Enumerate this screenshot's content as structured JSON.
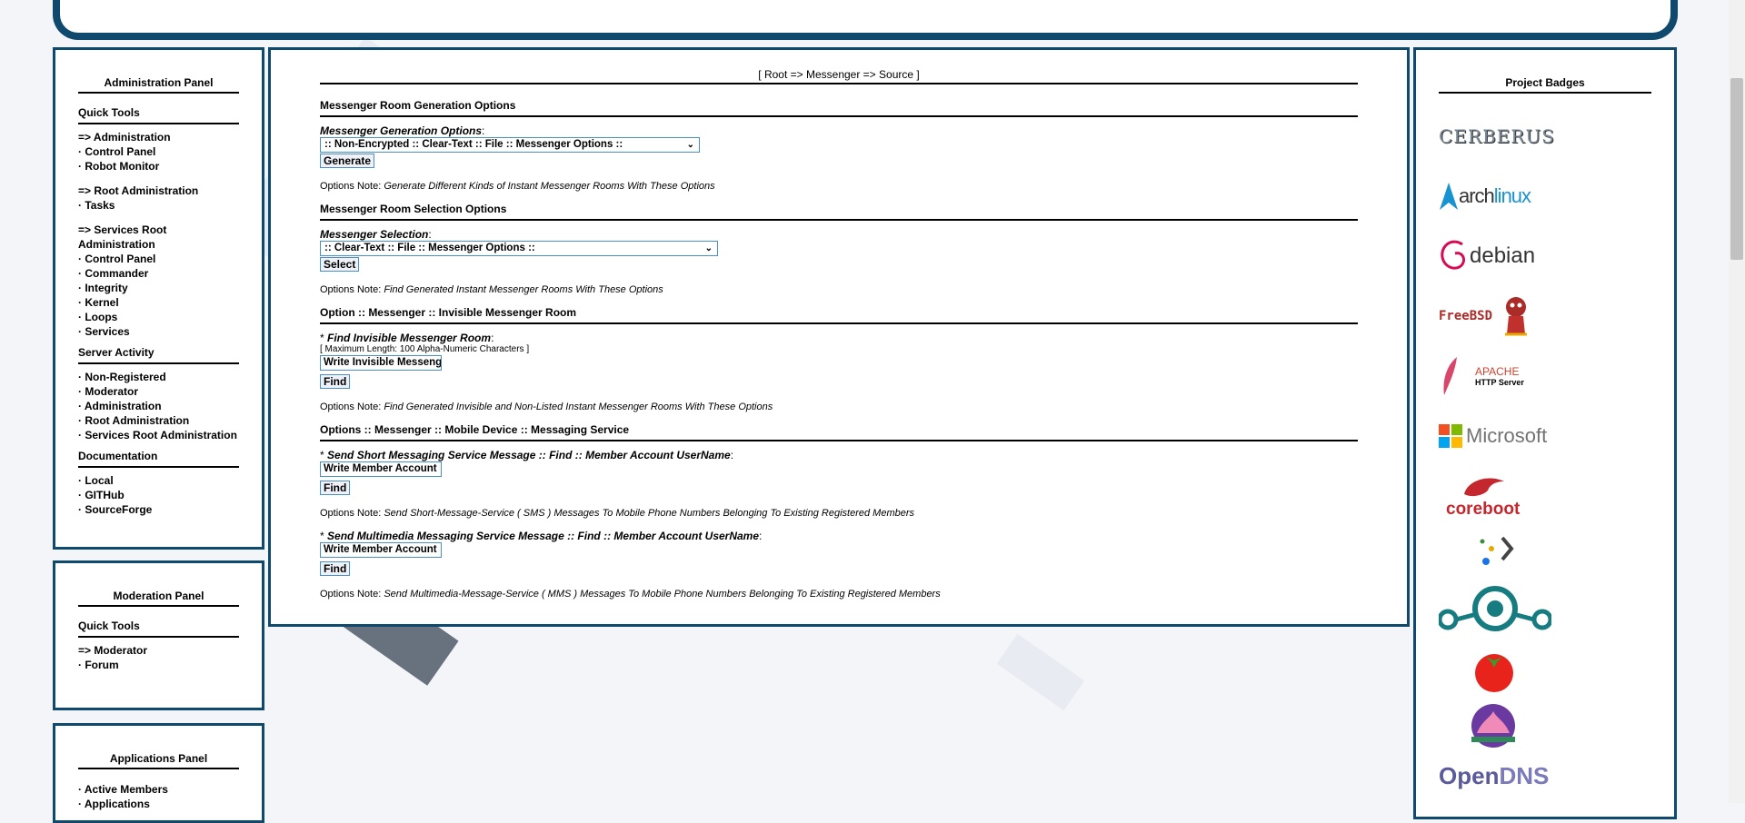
{
  "admin_panel": {
    "title": "Administration Panel",
    "sections": [
      {
        "heading": "Quick Tools",
        "groups": [
          [
            "=> Administration",
            "· Control Panel",
            "· Robot Monitor"
          ],
          [
            "=> Root Administration",
            "· Tasks"
          ],
          [
            "=> Services Root Administration",
            "· Control Panel",
            "· Commander",
            "· Integrity",
            "· Kernel",
            "· Loops",
            "· Services"
          ]
        ]
      },
      {
        "heading": "Server Activity",
        "groups": [
          [
            "· Non-Registered",
            "· Moderator",
            "· Administration",
            "· Root Administration",
            "· Services Root Administration"
          ]
        ]
      },
      {
        "heading": "Documentation",
        "groups": [
          [
            "· Local",
            "· GITHub",
            "· SourceForge"
          ]
        ]
      }
    ]
  },
  "moderation_panel": {
    "title": "Moderation Panel",
    "heading": "Quick Tools",
    "items": [
      "=> Moderator",
      "· Forum"
    ]
  },
  "applications_panel": {
    "title": "Applications Panel",
    "items": [
      "· Active Members",
      "· Applications"
    ]
  },
  "main": {
    "breadcrumb": "[ Root => Messenger => Source ]",
    "gen": {
      "heading": "Messenger Room Generation Options",
      "label": "Messenger Generation Options",
      "select_value": ":: Non-Encrypted :: Clear-Text :: File :: Messenger Options ::",
      "button": "Generate",
      "note_prefix": "Options Note: ",
      "note": "Generate Different Kinds of Instant Messenger Rooms With These Options"
    },
    "selection": {
      "heading": "Messenger Room Selection Options",
      "label": "Messenger Selection",
      "select_value": ":: Clear-Text :: File :: Messenger Options ::",
      "button": "Select",
      "note_prefix": "Options Note: ",
      "note": "Find Generated Instant Messenger Rooms With These Options"
    },
    "invisible": {
      "heading": "Option :: Messenger :: Invisible Messenger Room",
      "star": "* ",
      "label": "Find Invisible Messenger Room",
      "hint": "[ Maximum Length: 100 Alpha-Numeric Characters ]",
      "input_value": "Write Invisible Messenger Room",
      "button": "Find",
      "note_prefix": "Options Note: ",
      "note": "Find Generated Invisible and Non-Listed Instant Messenger Rooms With These Options"
    },
    "mobile": {
      "heading": "Options :: Messenger :: Mobile Device :: Messaging Service",
      "sms_star": "* ",
      "sms_label": "Send Short Messaging Service Message :: Find :: Member Account UserName",
      "sms_input": "Write Member Account",
      "sms_button": "Find",
      "sms_note_prefix": "Options Note: ",
      "sms_note": "Send Short-Message-Service ( SMS ) Messages To Mobile Phone Numbers Belonging To Existing Registered Members",
      "mms_star": "* ",
      "mms_label": "Send Multimedia Messaging Service Message :: Find :: Member Account UserName",
      "mms_input": "Write Member Account",
      "mms_button": "Find",
      "mms_note_prefix": "Options Note: ",
      "mms_note": "Send Multimedia-Message-Service ( MMS ) Messages To Mobile Phone Numbers Belonging To Existing Registered Members"
    }
  },
  "badges": {
    "title": "Project Badges",
    "items": [
      {
        "name": "cerberus-logo",
        "text": "CERBERUS"
      },
      {
        "name": "archlinux-logo",
        "text_a": "arch",
        "text_b": "linux"
      },
      {
        "name": "debian-logo",
        "text": "debian"
      },
      {
        "name": "freebsd-logo",
        "text": "FreeBSD"
      },
      {
        "name": "apache-logo",
        "text_a": "APACHE",
        "text_b": "HTTP Server"
      },
      {
        "name": "microsoft-logo",
        "text": "Microsoft"
      },
      {
        "name": "coreboot-logo",
        "text": "coreboot"
      },
      {
        "name": "prompt-logo"
      },
      {
        "name": "lineageos-logo"
      },
      {
        "name": "tomato-logo"
      },
      {
        "name": "lotus-logo"
      },
      {
        "name": "opendns-logo",
        "text_a": "Open",
        "text_b": "DNS"
      }
    ],
    "colors": {
      "arch": "#1793d1",
      "debian": "#d70a53",
      "freebsd": "#ab2b28",
      "coreboot": "#c4272d",
      "opendns": "#5a5a9c",
      "lineage": "#167c80"
    }
  }
}
